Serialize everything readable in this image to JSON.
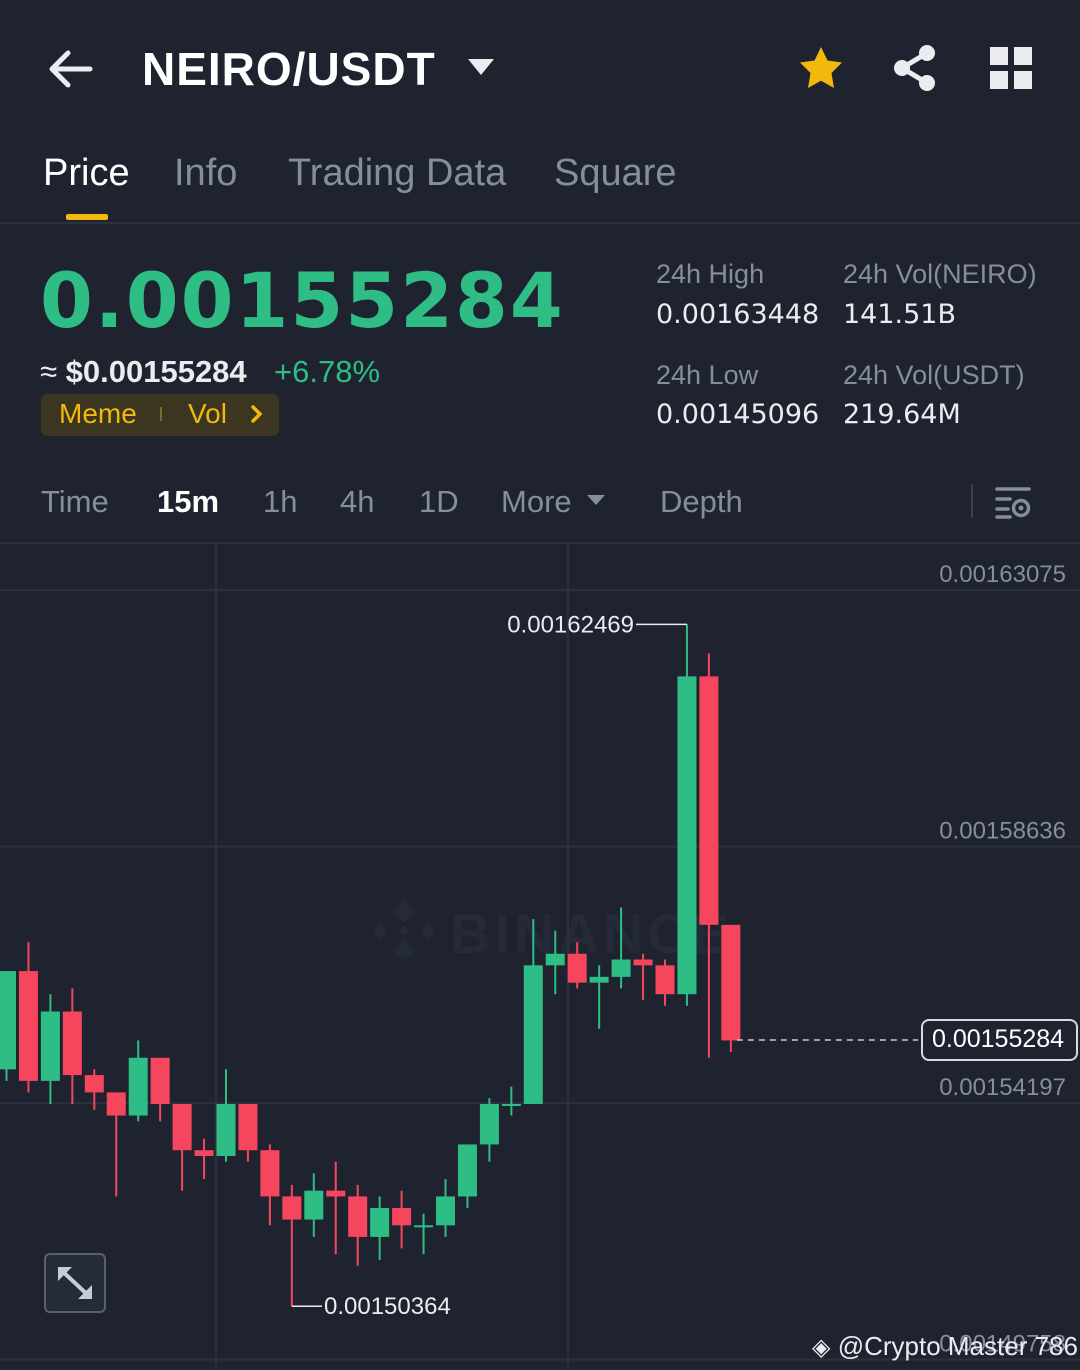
{
  "header": {
    "pair": "NEIRO/USDT"
  },
  "tabs": [
    {
      "label": "Price"
    },
    {
      "label": "Info"
    },
    {
      "label": "Trading Data"
    },
    {
      "label": "Square"
    }
  ],
  "ticker": {
    "last_price": "0.00155284",
    "approx_prefix": "≈ ",
    "approx_usd": "$0.00155284",
    "change": "+6.78%",
    "tags": [
      "Meme",
      "Vol"
    ],
    "high_label": "24h High",
    "high_value": "0.00163448",
    "low_label": "24h Low",
    "low_value": "0.00145096",
    "vol_base_label": "24h Vol(NEIRO)",
    "vol_base_value": "141.51B",
    "vol_quote_label": "24h Vol(USDT)",
    "vol_quote_value": "219.64M"
  },
  "timeframes": {
    "time": "Time",
    "m15": "15m",
    "h1": "1h",
    "h4": "4h",
    "d1": "1D",
    "more": "More",
    "depth": "Depth",
    "selected": "15m"
  },
  "chart_data": {
    "type": "candlestick",
    "interval": "15m",
    "y_axis_ticks": [
      "0.00163075",
      "0.00158636",
      "0.00154197",
      "0.00149758"
    ],
    "annotations": {
      "high": "0.00162469",
      "low": "0.00150364",
      "last": "0.00155284"
    },
    "colors": {
      "up": "#2ebd85",
      "down": "#f6465d"
    },
    "candles": [
      {
        "o": 0.0015478,
        "h": 0.0015648,
        "l": 0.0015458,
        "c": 0.0015648
      },
      {
        "o": 0.0015648,
        "h": 0.0015698,
        "l": 0.0015438,
        "c": 0.0015458
      },
      {
        "o": 0.0015458,
        "h": 0.0015608,
        "l": 0.0015418,
        "c": 0.0015578
      },
      {
        "o": 0.0015578,
        "h": 0.0015618,
        "l": 0.0015418,
        "c": 0.0015468
      },
      {
        "o": 0.0015468,
        "h": 0.0015478,
        "l": 0.0015408,
        "c": 0.0015438
      },
      {
        "o": 0.0015438,
        "h": 0.0015438,
        "l": 0.0015258,
        "c": 0.0015398
      },
      {
        "o": 0.0015398,
        "h": 0.0015528,
        "l": 0.0015388,
        "c": 0.0015498
      },
      {
        "o": 0.0015498,
        "h": 0.0015498,
        "l": 0.0015388,
        "c": 0.0015418
      },
      {
        "o": 0.0015418,
        "h": 0.0015418,
        "l": 0.0015268,
        "c": 0.0015338
      },
      {
        "o": 0.0015338,
        "h": 0.0015358,
        "l": 0.0015288,
        "c": 0.0015328
      },
      {
        "o": 0.0015328,
        "h": 0.0015478,
        "l": 0.0015318,
        "c": 0.0015418
      },
      {
        "o": 0.0015418,
        "h": 0.0015418,
        "l": 0.0015318,
        "c": 0.0015338
      },
      {
        "o": 0.0015338,
        "h": 0.0015348,
        "l": 0.0015208,
        "c": 0.0015258
      },
      {
        "o": 0.0015258,
        "h": 0.0015278,
        "l": 0.0015068,
        "c": 0.0015218
      },
      {
        "o": 0.0015218,
        "h": 0.0015298,
        "l": 0.0015188,
        "c": 0.0015268
      },
      {
        "o": 0.0015268,
        "h": 0.0015318,
        "l": 0.0015158,
        "c": 0.0015258
      },
      {
        "o": 0.0015258,
        "h": 0.0015278,
        "l": 0.0015138,
        "c": 0.0015188
      },
      {
        "o": 0.0015188,
        "h": 0.0015258,
        "l": 0.0015148,
        "c": 0.0015238
      },
      {
        "o": 0.0015238,
        "h": 0.0015268,
        "l": 0.0015168,
        "c": 0.0015208
      },
      {
        "o": 0.0015208,
        "h": 0.0015228,
        "l": 0.0015158,
        "c": 0.0015208
      },
      {
        "o": 0.0015208,
        "h": 0.0015288,
        "l": 0.0015188,
        "c": 0.0015258
      },
      {
        "o": 0.0015258,
        "h": 0.0015338,
        "l": 0.0015238,
        "c": 0.0015348
      },
      {
        "o": 0.0015348,
        "h": 0.0015428,
        "l": 0.0015318,
        "c": 0.0015418
      },
      {
        "o": 0.0015418,
        "h": 0.0015448,
        "l": 0.0015398,
        "c": 0.0015418
      },
      {
        "o": 0.0015418,
        "h": 0.0015738,
        "l": 0.0015418,
        "c": 0.0015658
      },
      {
        "o": 0.0015658,
        "h": 0.0015718,
        "l": 0.0015608,
        "c": 0.0015678
      },
      {
        "o": 0.0015678,
        "h": 0.0015698,
        "l": 0.0015618,
        "c": 0.0015628
      },
      {
        "o": 0.0015628,
        "h": 0.0015658,
        "l": 0.0015548,
        "c": 0.0015638
      },
      {
        "o": 0.0015638,
        "h": 0.0015758,
        "l": 0.0015618,
        "c": 0.0015668
      },
      {
        "o": 0.0015668,
        "h": 0.0015678,
        "l": 0.0015598,
        "c": 0.0015658
      },
      {
        "o": 0.0015658,
        "h": 0.0015668,
        "l": 0.0015588,
        "c": 0.0015608
      },
      {
        "o": 0.0015608,
        "h": 0.0016248,
        "l": 0.0015588,
        "c": 0.0016158
      },
      {
        "o": 0.0016158,
        "h": 0.0016198,
        "l": 0.0015498,
        "c": 0.0015728
      },
      {
        "o": 0.0015728,
        "h": 0.0015728,
        "l": 0.0015508,
        "c": 0.0015528
      }
    ]
  },
  "credit": "@Crypto Master 786"
}
